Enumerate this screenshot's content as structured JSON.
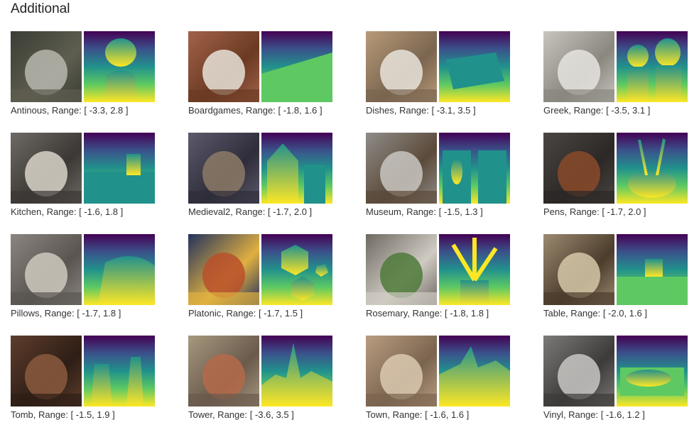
{
  "section": {
    "title": "Additional"
  },
  "scenes": [
    {
      "caption": "Antinous, Range: [ -3.3, 2.8 ]",
      "scene_icon": "bust-statue",
      "rgb_palette": [
        "#3a3e34",
        "#b9b7ae",
        "#5e5d50"
      ],
      "depth_shape": "bust"
    },
    {
      "caption": "Boardgames, Range: [ -1.8, 1.6 ]",
      "scene_icon": "chessboard",
      "rgb_palette": [
        "#a2624a",
        "#e8e2d8",
        "#6b3a22"
      ],
      "depth_shape": "board"
    },
    {
      "caption": "Dishes, Range: [ -3.1, 3.5 ]",
      "scene_icon": "dish-rack",
      "rgb_palette": [
        "#b89b78",
        "#e9e4dc",
        "#7a6550"
      ],
      "depth_shape": "rack"
    },
    {
      "caption": "Greek, Range: [ -3.5, 3.1 ]",
      "scene_icon": "two-busts",
      "rgb_palette": [
        "#c8c5be",
        "#e6e4df",
        "#8a877f"
      ],
      "depth_shape": "two-busts"
    },
    {
      "caption": "Kitchen, Range: [ -1.6, 1.8 ]",
      "scene_icon": "kitchen-counter",
      "rgb_palette": [
        "#6e6a64",
        "#d9d4c9",
        "#3b3835"
      ],
      "depth_shape": "kitchen"
    },
    {
      "caption": "Medieval2, Range: [ -1.7, 2.0 ]",
      "scene_icon": "medieval-house",
      "rgb_palette": [
        "#5c5a6b",
        "#8c7a66",
        "#2f2d3a"
      ],
      "depth_shape": "house"
    },
    {
      "caption": "Museum, Range: [ -1.5, 1.3 ]",
      "scene_icon": "glass-vitrines",
      "rgb_palette": [
        "#8f8c88",
        "#c9c6c1",
        "#5b4a3a"
      ],
      "depth_shape": "vitrine"
    },
    {
      "caption": "Pens, Range: [ -1.7, 2.0 ]",
      "scene_icon": "pen-pot",
      "rgb_palette": [
        "#4a4642",
        "#8a4a2a",
        "#2b2826"
      ],
      "depth_shape": "pot"
    },
    {
      "caption": "Pillows, Range: [ -1.7, 1.8 ]",
      "scene_icon": "pillows",
      "rgb_palette": [
        "#8a8580",
        "#cfc9c0",
        "#5a5550"
      ],
      "depth_shape": "pillows"
    },
    {
      "caption": "Platonic, Range: [ -1.7, 1.5 ]",
      "scene_icon": "polyhedra",
      "rgb_palette": [
        "#23325e",
        "#b8502c",
        "#e0b040"
      ],
      "depth_shape": "hexagons"
    },
    {
      "caption": "Rosemary, Range: [ -1.8, 1.8 ]",
      "scene_icon": "potted-plant",
      "rgb_palette": [
        "#6e6a62",
        "#4d7a3a",
        "#cfcac2"
      ],
      "depth_shape": "plant"
    },
    {
      "caption": "Table, Range: [ -2.0, 1.6 ]",
      "scene_icon": "desk-drawers",
      "rgb_palette": [
        "#9c8a70",
        "#d6c8a8",
        "#4b3c2c"
      ],
      "depth_shape": "desk"
    },
    {
      "caption": "Tomb, Range: [ -1.5, 1.9 ]",
      "scene_icon": "tomb-interior",
      "rgb_palette": [
        "#5e3d2c",
        "#8a5a3e",
        "#2e1e16"
      ],
      "depth_shape": "tomb"
    },
    {
      "caption": "Tower, Range: [ -3.6, 3.5 ]",
      "scene_icon": "town-tower",
      "rgb_palette": [
        "#a7987f",
        "#b56a4a",
        "#6a5a4c"
      ],
      "depth_shape": "tower"
    },
    {
      "caption": "Town, Range: [ -1.6, 1.6 ]",
      "scene_icon": "town-aerial",
      "rgb_palette": [
        "#b99d80",
        "#dcc9b0",
        "#7a6450"
      ],
      "depth_shape": "town"
    },
    {
      "caption": "Vinyl, Range: [ -1.6, 1.2 ]",
      "scene_icon": "turntable",
      "rgb_palette": [
        "#7c7a78",
        "#c9c7c4",
        "#3d3b39"
      ],
      "depth_shape": "turntable"
    }
  ],
  "depth_colormap": [
    "#440154",
    "#3b528b",
    "#21918c",
    "#5ec962",
    "#fde725"
  ]
}
